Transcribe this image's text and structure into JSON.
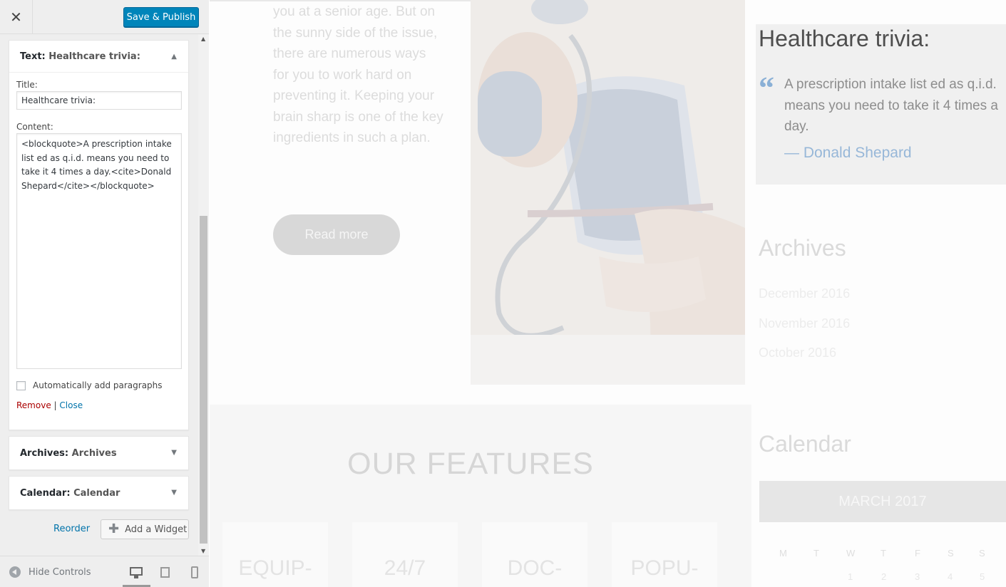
{
  "header": {
    "close_icon": "close-icon",
    "save_label": "Save & Publish"
  },
  "widgets": {
    "text": {
      "type_label": "Text:",
      "name": "Healthcare trivia:",
      "title_label": "Title:",
      "title_value": "Healthcare trivia:",
      "content_label": "Content:",
      "content_value": "<blockquote>A prescription intake list ed as q.i.d. means you need to take it 4 times a day.<cite>Donald Shepard</cite></blockquote>",
      "autop_label": "Automatically add paragraphs",
      "autop_checked": false,
      "remove_label": "Remove",
      "separator": "|",
      "close_label": "Close"
    },
    "archives": {
      "type_label": "Archives:",
      "name": "Archives"
    },
    "calendar": {
      "type_label": "Calendar:",
      "name": "Calendar"
    }
  },
  "actions": {
    "reorder_label": "Reorder",
    "add_widget_label": "Add a Widget"
  },
  "footer": {
    "hide_controls_label": "Hide Controls",
    "devices": [
      "desktop",
      "tablet",
      "mobile"
    ],
    "active_device": "desktop"
  },
  "preview": {
    "intro_text": "you at a senior age. But on the sunny side of the issue, there are numerous ways for you to work hard on preventing it. Keeping your brain sharp is one of the key ingredients in such a plan.",
    "read_more": "Read more",
    "features_title": "OUR FEATURES",
    "features": [
      "EQUIP-",
      "24/7",
      "DOC-",
      "POPU-"
    ],
    "trivia": {
      "title": "Healthcare trivia:",
      "quote": "A prescription intake list ed as q.i.d. means you need to take it 4 times a day.",
      "cite": "— Donald Shepard"
    },
    "archives": {
      "title": "Archives",
      "items": [
        "December 2016",
        "November 2016",
        "October 2016"
      ]
    },
    "calendar": {
      "title": "Calendar",
      "month": "MARCH 2017",
      "weekdays": [
        "M",
        "T",
        "W",
        "T",
        "F",
        "S",
        "S"
      ],
      "first_row": [
        "1",
        "2",
        "3",
        "4",
        "5"
      ]
    }
  },
  "colors": {
    "primary_button": "#0085ba",
    "link": "#0073aa",
    "remove": "#aa0000",
    "quote_accent": "#8ab0d6"
  }
}
